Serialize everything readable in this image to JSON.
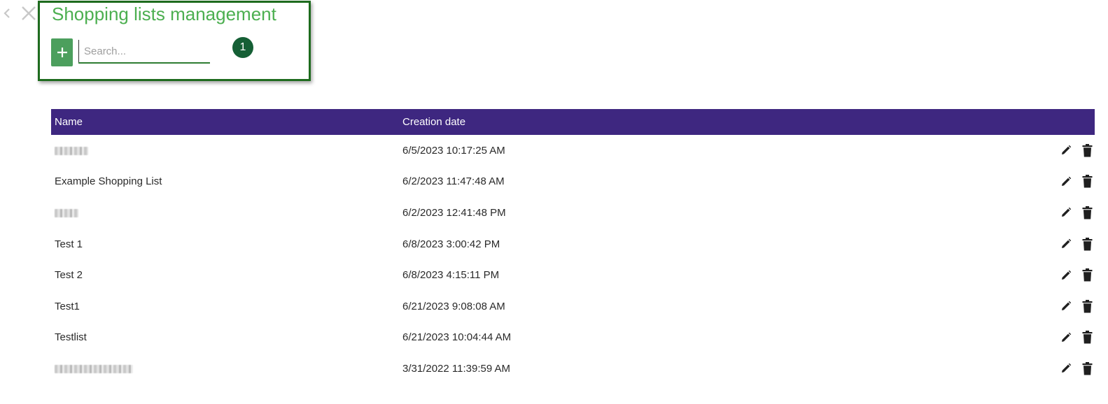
{
  "header": {
    "title": "Shopping lists management",
    "add_label": "+",
    "search_placeholder": "Search...",
    "step_badge": "1"
  },
  "table": {
    "columns": [
      "Name",
      "Creation date"
    ],
    "rows": [
      {
        "name": "",
        "name_obscured": true,
        "date": "6/5/2023 10:17:25 AM"
      },
      {
        "name": "Example Shopping List",
        "name_obscured": false,
        "date": "6/2/2023 11:47:48 AM"
      },
      {
        "name": "",
        "name_obscured": true,
        "date": "6/2/2023 12:41:48 PM"
      },
      {
        "name": "Test 1",
        "name_obscured": false,
        "date": "6/8/2023 3:00:42 PM"
      },
      {
        "name": "Test 2",
        "name_obscured": false,
        "date": "6/8/2023 4:15:11 PM"
      },
      {
        "name": "Test1",
        "name_obscured": false,
        "date": "6/21/2023 9:08:08 AM"
      },
      {
        "name": "Testlist",
        "name_obscured": false,
        "date": "6/21/2023 10:04:44 AM"
      },
      {
        "name": "",
        "name_obscured": true,
        "date": "3/31/2022 11:39:59 AM"
      }
    ],
    "row_icons": [
      "pencil-icon",
      "trash-icon"
    ]
  },
  "colors": {
    "title": "#4caf50",
    "add_button": "#4c9f5d",
    "header_bg": "#3e2780",
    "badge": "#155f35",
    "highlight_border": "#1e6b1e"
  }
}
